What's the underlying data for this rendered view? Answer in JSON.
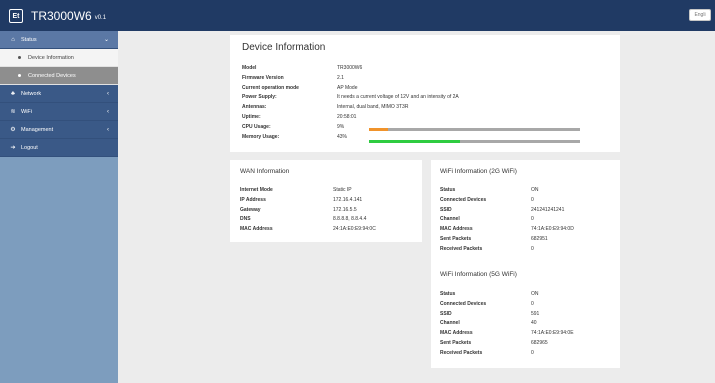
{
  "header": {
    "logo": "Et",
    "title": "TR3000W6",
    "version": "v0.1",
    "language_button": "Engli"
  },
  "sidebar": {
    "status": "Status",
    "device_information": "Device Information",
    "connected_devices": "Connected Devices",
    "network": "Network",
    "wifi": "WiFi",
    "management": "Management",
    "logout": "Logout"
  },
  "device_info": {
    "title": "Device Information",
    "rows": [
      {
        "label": "Model",
        "value": "TR3000W6"
      },
      {
        "label": "Firmware Version",
        "value": "2.1"
      },
      {
        "label": "Current operation mode",
        "value": "AP Mode"
      },
      {
        "label": "Power Supply:",
        "value": "It needs a current voltage of 12V and an intensity of 2A"
      },
      {
        "label": "Antennas:",
        "value": "Internal, dual band, MIMO 3T3R"
      },
      {
        "label": "Uptime:",
        "value": "20:58:01"
      },
      {
        "label": "CPU Usage:",
        "value": "9%"
      },
      {
        "label": "Memory Usage:",
        "value": "43%"
      }
    ],
    "cpu_usage_fraction": 0.09,
    "memory_usage_fraction": 0.43,
    "cpu_bar_color": "#f0932b",
    "memory_bar_color": "#2ecc40"
  },
  "wan": {
    "title": "WAN Information",
    "rows": [
      {
        "label": "Internet Mode",
        "value": "Static IP"
      },
      {
        "label": "IP Address",
        "value": "172.16.4.141"
      },
      {
        "label": "Gateway",
        "value": "172.16.5.5"
      },
      {
        "label": "DNS",
        "value": "8.8.8.8, 8.8.4.4"
      },
      {
        "label": "MAC Address",
        "value": "24:1A:E0:E9:94:0C"
      }
    ]
  },
  "wifi24": {
    "title": "WiFi Information (2G WiFi)",
    "rows": [
      {
        "label": "Status",
        "value": "ON"
      },
      {
        "label": "Connected Devices",
        "value": "0"
      },
      {
        "label": "SSID",
        "value": "241241241241"
      },
      {
        "label": "Channel",
        "value": "0"
      },
      {
        "label": "MAC Address",
        "value": "74:1A:E0:E9:94:0D"
      },
      {
        "label": "Sent Packets",
        "value": "682951"
      },
      {
        "label": "Received Packets",
        "value": "0"
      }
    ]
  },
  "wifi5": {
    "title": "WiFi Information (5G WiFi)",
    "rows": [
      {
        "label": "Status",
        "value": "ON"
      },
      {
        "label": "Connected Devices",
        "value": "0"
      },
      {
        "label": "SSID",
        "value": "591"
      },
      {
        "label": "Channel",
        "value": "40"
      },
      {
        "label": "MAC Address",
        "value": "74:1A:E0:E9:94:0E"
      },
      {
        "label": "Sent Packets",
        "value": "682965"
      },
      {
        "label": "Received Packets",
        "value": "0"
      }
    ]
  }
}
